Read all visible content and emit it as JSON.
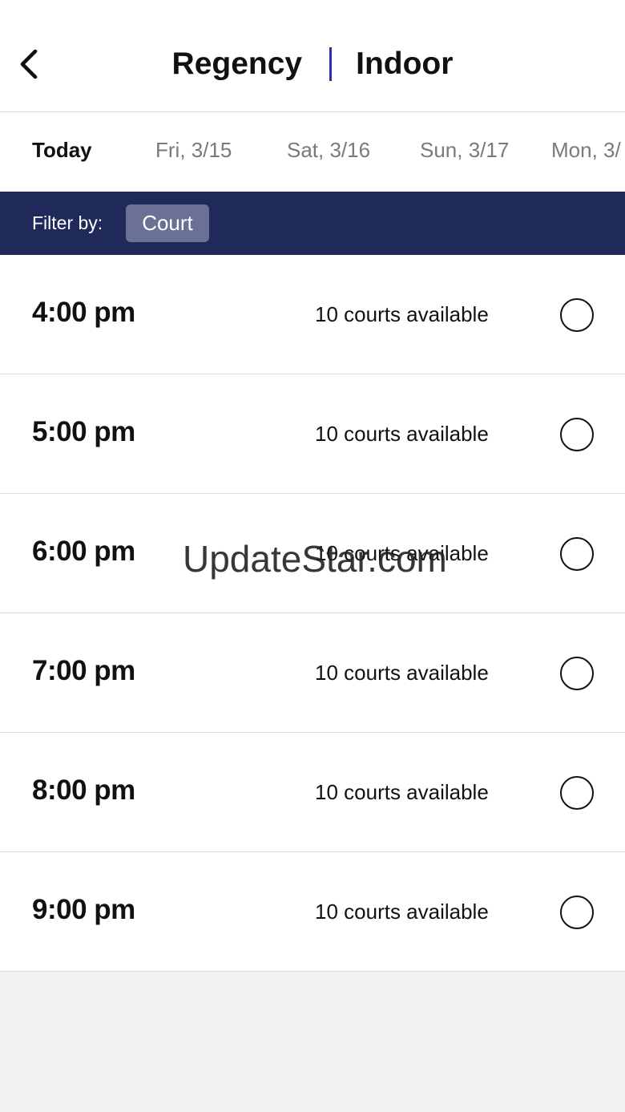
{
  "header": {
    "back_icon": "chevron-left-icon",
    "title_left": "Regency",
    "title_right": "Indoor",
    "separator_color": "#2d2fa8"
  },
  "date_tabs": [
    {
      "label": "Today",
      "active": true
    },
    {
      "label": "Fri, 3/15",
      "active": false
    },
    {
      "label": "Sat, 3/16",
      "active": false
    },
    {
      "label": "Sun, 3/17",
      "active": false
    },
    {
      "label": "Mon, 3/",
      "active": false
    }
  ],
  "filter": {
    "label": "Filter by:",
    "chip": "Court",
    "bar_color": "#1f2a5a"
  },
  "slots": [
    {
      "time": "4:00 pm",
      "availability": "10 courts available"
    },
    {
      "time": "5:00 pm",
      "availability": "10 courts available"
    },
    {
      "time": "6:00 pm",
      "availability": "10 courts available"
    },
    {
      "time": "7:00 pm",
      "availability": "10 courts available"
    },
    {
      "time": "8:00 pm",
      "availability": "10 courts available"
    },
    {
      "time": "9:00 pm",
      "availability": "10 courts available"
    }
  ],
  "watermark": "UpdateStar.com"
}
